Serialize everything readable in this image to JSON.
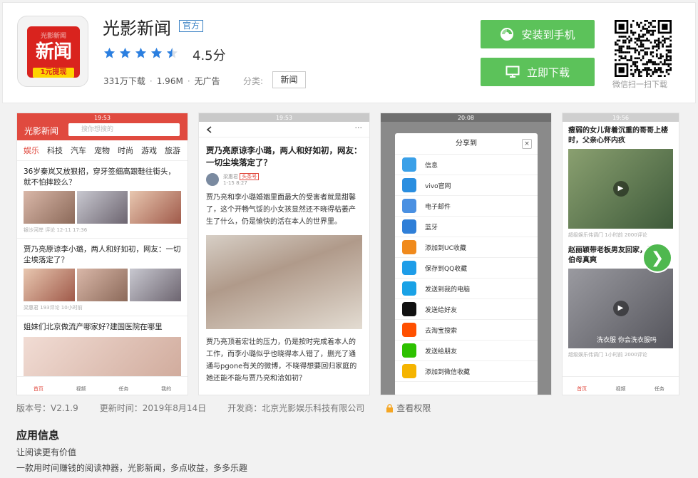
{
  "app": {
    "icon_text": "新闻",
    "icon_tag": "1元提现",
    "icon_ghost": "光影新闻",
    "name": "光影新闻",
    "official_badge": "官方",
    "rating": "4.5分",
    "rating_value": 4.5,
    "rating_max": 5,
    "downloads": "331万下载",
    "size": "1.96M",
    "ads": "无广告",
    "category_label": "分类:",
    "category": "新闻"
  },
  "actions": {
    "install_label": "安装到手机",
    "download_label": "立即下载",
    "qr_caption": "微信扫一扫下载"
  },
  "colors": {
    "accent_green": "#5cc25a",
    "star_blue": "#2b7fe0",
    "brand_red": "#d9231e"
  },
  "screens": {
    "s1": {
      "status_time": "19:53",
      "brand": "光影新闻",
      "search_placeholder": "搜你想搜的",
      "categories": [
        "娱乐",
        "科技",
        "汽车",
        "宠物",
        "时尚",
        "游戏",
        "旅游"
      ],
      "news": [
        {
          "title": "36岁秦岚又放狠招，穿牙签细高跟鞋往街头，就不怕摔跤么？",
          "source": "银沙河岸 评论 12-11 17:36"
        },
        {
          "title": "贾乃亮原谅李小璐，两人和好如初，网友：一切尘埃落定了？",
          "source": "梁惠君 193评论 10小时前"
        },
        {
          "title": "姐妹们北京做流产哪家好?建国医院在哪里",
          "source": ""
        }
      ],
      "tabs": [
        "首页",
        "视频",
        "任务",
        "我的"
      ]
    },
    "s2": {
      "status_time": "19:53",
      "title": "贾乃亮原谅李小璐，两人和好如初，网友：一切尘埃落定了？",
      "author": "梁惠君",
      "author_tag": "头条号",
      "date": "1-15 8:27",
      "para1": "贾乃亮和李小璐婚姻里面最大的受害者就是甜馨了，这个开畅气馁的小女孩显然还不晓得枯萎产生了什么，仍是愉快的活在本人的世界里。",
      "para2": "贾乃亮顶着宏壮的压力，仍是按时完成着本人的工作，而李小璐似乎也晓得本人错了，删光了通通与pgone有关的微博，不晓得想要回归家庭的她还能不能与贾乃亮和洽如初？"
    },
    "s3": {
      "status_time": "20:08",
      "share_title": "分享到",
      "close": "×",
      "items": [
        {
          "label": "信息",
          "color": "#3aa0e8"
        },
        {
          "label": "vivo官网",
          "color": "#2a8ee0"
        },
        {
          "label": "电子邮件",
          "color": "#4a90e2"
        },
        {
          "label": "蓝牙",
          "color": "#2f7fd8"
        },
        {
          "label": "添加到UC收藏",
          "color": "#f08a1c"
        },
        {
          "label": "保存到QQ收藏",
          "color": "#1e9de8"
        },
        {
          "label": "发送到我的电脑",
          "color": "#1aa2e6"
        },
        {
          "label": "发送给好友",
          "color": "#111111"
        },
        {
          "label": "去淘宝搜索",
          "color": "#ff5000"
        },
        {
          "label": "发送给朋友",
          "color": "#2dc100"
        },
        {
          "label": "添加到微信收藏",
          "color": "#f5b400"
        }
      ]
    },
    "s4": {
      "status_time": "19:56",
      "news": [
        {
          "title": "瘦弱的女儿背着沉重的哥哥上楼时，父亲心怀内疚",
          "source": "超级娱乐伟调门 1小时前 2000评论"
        },
        {
          "title": "赵丽颖带老板男友回家，打脸大伯母真爽",
          "source": "超级娱乐伟调门 1小时前 2000评论",
          "caption": "洗衣服 你会洗衣服吗"
        }
      ],
      "tabs": [
        "首页",
        "视频",
        "任务"
      ]
    }
  },
  "details": {
    "version": "版本号：V2.1.9",
    "updated": "更新时间：2019年8月14日",
    "developer": "开发商：北京光影娱乐科技有限公司",
    "permissions": "查看权限"
  },
  "info": {
    "title": "应用信息",
    "line1": "让阅读更有价值",
    "line2": "一款用时间赚钱的阅读神器，光影新闻，多点收益，多多乐趣"
  }
}
